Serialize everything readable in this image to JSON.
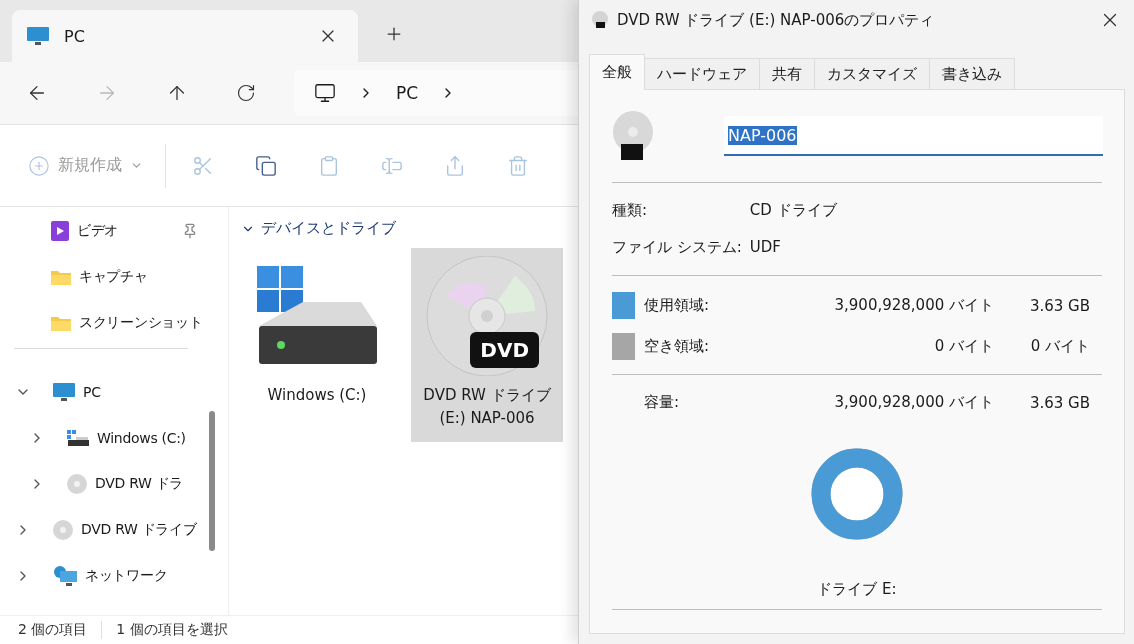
{
  "explorer": {
    "tab": {
      "title": "PC"
    },
    "address": {
      "crumbs": [
        "PC"
      ]
    },
    "toolbar": {
      "new_label": "新規作成",
      "new_disabled": true,
      "actions": [
        {
          "kind": "cut",
          "disabled": true
        },
        {
          "kind": "copy",
          "disabled": false
        },
        {
          "kind": "paste",
          "disabled": true
        },
        {
          "kind": "rename",
          "disabled": true
        },
        {
          "kind": "share",
          "disabled": true
        },
        {
          "kind": "delete",
          "disabled": true
        }
      ]
    },
    "quick_access": [
      {
        "label": "ビデオ",
        "kind": "video",
        "pinned": true
      },
      {
        "label": "キャプチャ",
        "kind": "folder",
        "pinned": false
      },
      {
        "label": "スクリーンショット",
        "kind": "folder",
        "pinned": false
      }
    ],
    "tree": [
      {
        "label": "PC",
        "kind": "pc",
        "expanded": true,
        "children": [
          {
            "label": "Windows (C:)",
            "kind": "drive",
            "expanded": false
          },
          {
            "label": "DVD RW ドラ",
            "kind": "disc",
            "expanded": false
          }
        ]
      },
      {
        "label": "DVD RW ドライブ",
        "kind": "disc",
        "expanded": false
      },
      {
        "label": "ネットワーク",
        "kind": "network",
        "expanded": false
      }
    ],
    "group": {
      "title": "デバイスとドライブ",
      "expanded": true
    },
    "items": [
      {
        "label": "Windows (C:)",
        "kind": "drive",
        "selected": false
      },
      {
        "label": "DVD RW ドライブ (E:) NAP-006",
        "kind": "disc",
        "badge": "DVD",
        "selected": true
      }
    ],
    "status": [
      "2 個の項目",
      "1 個の項目を選択"
    ]
  },
  "dialog": {
    "title": "DVD RW ドライブ (E:) NAP-006のプロパティ",
    "tabs": [
      {
        "label": "全般",
        "selected": true
      },
      {
        "label": "ハードウェア",
        "selected": false
      },
      {
        "label": "共有",
        "selected": false
      },
      {
        "label": "カスタマイズ",
        "selected": false
      },
      {
        "label": "書き込み",
        "selected": false
      }
    ],
    "name": {
      "value": "NAP-006",
      "highlighted": true
    },
    "info": [
      {
        "label": "種類:",
        "value": "CD ドライブ"
      },
      {
        "label": "ファイル システム:",
        "value": "UDF"
      }
    ],
    "usage": [
      {
        "label": "使用領域:",
        "bytes": "3,900,928,000 バイト",
        "size": "3.63 GB",
        "color": "#4a9bd5"
      },
      {
        "label": "空き領域:",
        "bytes": "0 バイト",
        "size": "0 バイト",
        "color": "#a6a6a6"
      }
    ],
    "capacity": {
      "label": "容量:",
      "bytes": "3,900,928,000 バイト",
      "size": "3.63 GB"
    },
    "donut": {
      "level": 1
    },
    "drive_label": "ドライブ E:"
  }
}
